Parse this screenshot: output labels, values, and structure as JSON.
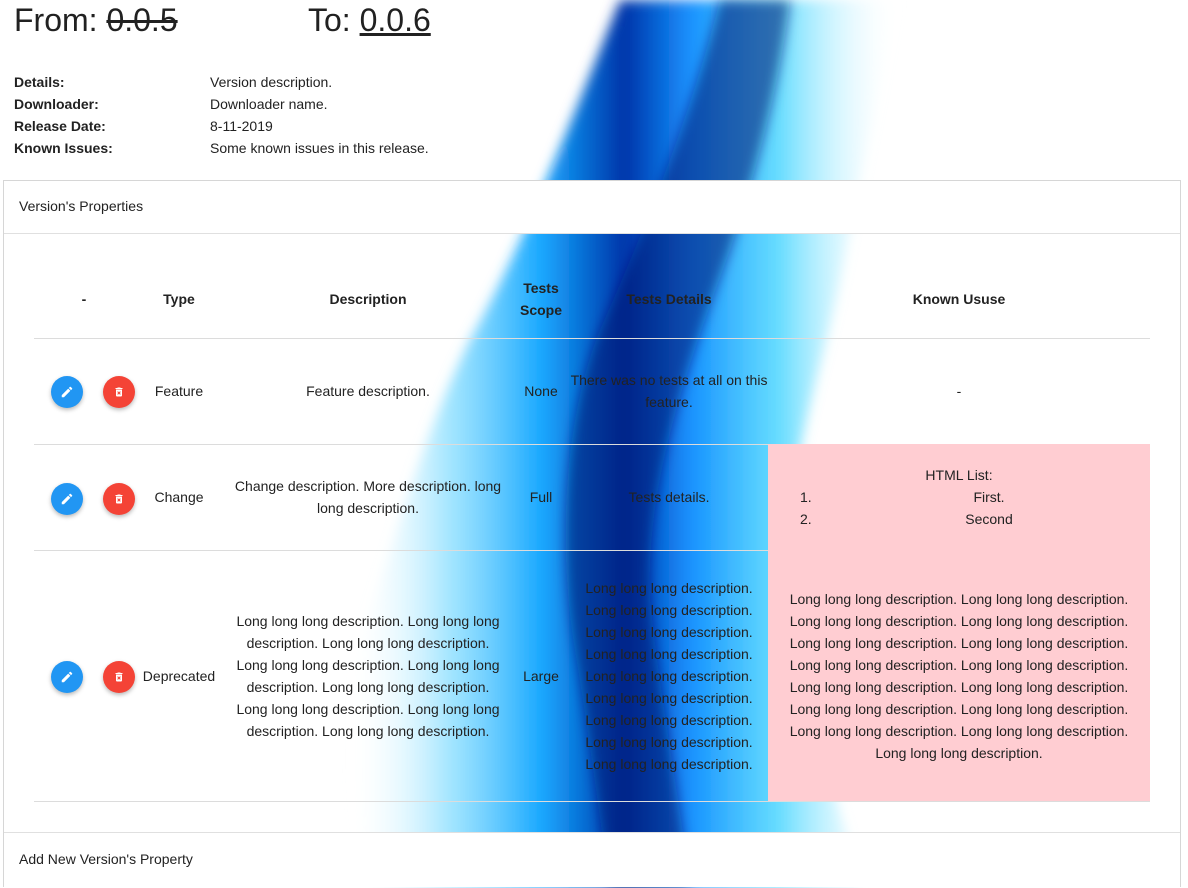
{
  "versions": {
    "from_label": "From:",
    "from_value": "0.0.5",
    "to_label": "To:",
    "to_value": "0.0.6"
  },
  "meta": [
    {
      "label": "Details:",
      "value": "Version description."
    },
    {
      "label": "Downloader:",
      "value": "Downloader name."
    },
    {
      "label": "Release Date:",
      "value": "8-11-2019"
    },
    {
      "label": "Known Issues:",
      "value": "Some known issues in this release."
    }
  ],
  "card": {
    "title": "Version's Properties",
    "footer": "Add New Version's Property"
  },
  "table": {
    "headers": {
      "actions": "-",
      "type": "Type",
      "description": "Description",
      "tests_scope": "Tests Scope",
      "tests_details": "Tests Details",
      "known_issue": "Known Ususe"
    },
    "rows": [
      {
        "type": "Feature",
        "description": "Feature description.",
        "tests_scope": "None",
        "tests_details": "There was no tests at all on this feature.",
        "known_issue": "-"
      },
      {
        "type": "Change",
        "description": "Change description. More description. long long description.",
        "tests_scope": "Full",
        "tests_details": "Tests details.",
        "known_issue_title": "HTML List:",
        "known_issue_list": [
          {
            "num": "1.",
            "text": "First."
          },
          {
            "num": "2.",
            "text": "Second"
          }
        ]
      },
      {
        "type": "Deprecated",
        "description": "Long long long description. Long long long description. Long long long description. Long long long description. Long long long description. Long long long description. Long long long description. Long long long description. Long long long description.",
        "tests_scope": "Large",
        "tests_details": "Long long long description. Long long long description. Long long long description. Long long long description. Long long long description. Long long long description. Long long long description. Long long long description. Long long long description.",
        "known_issue": "Long long long description. Long long long description. Long long long description. Long long long description. Long long long description. Long long long description. Long long long description. Long long long description. Long long long description. Long long long description. Long long long description. Long long long description. Long long long description. Long long long description. Long long long description."
      }
    ]
  },
  "icons": {
    "edit": "pencil-icon",
    "delete": "trash-icon"
  },
  "colors": {
    "edit_button": "#2196f3",
    "delete_button": "#f44336",
    "issue_highlight": "#ffcdd2"
  }
}
